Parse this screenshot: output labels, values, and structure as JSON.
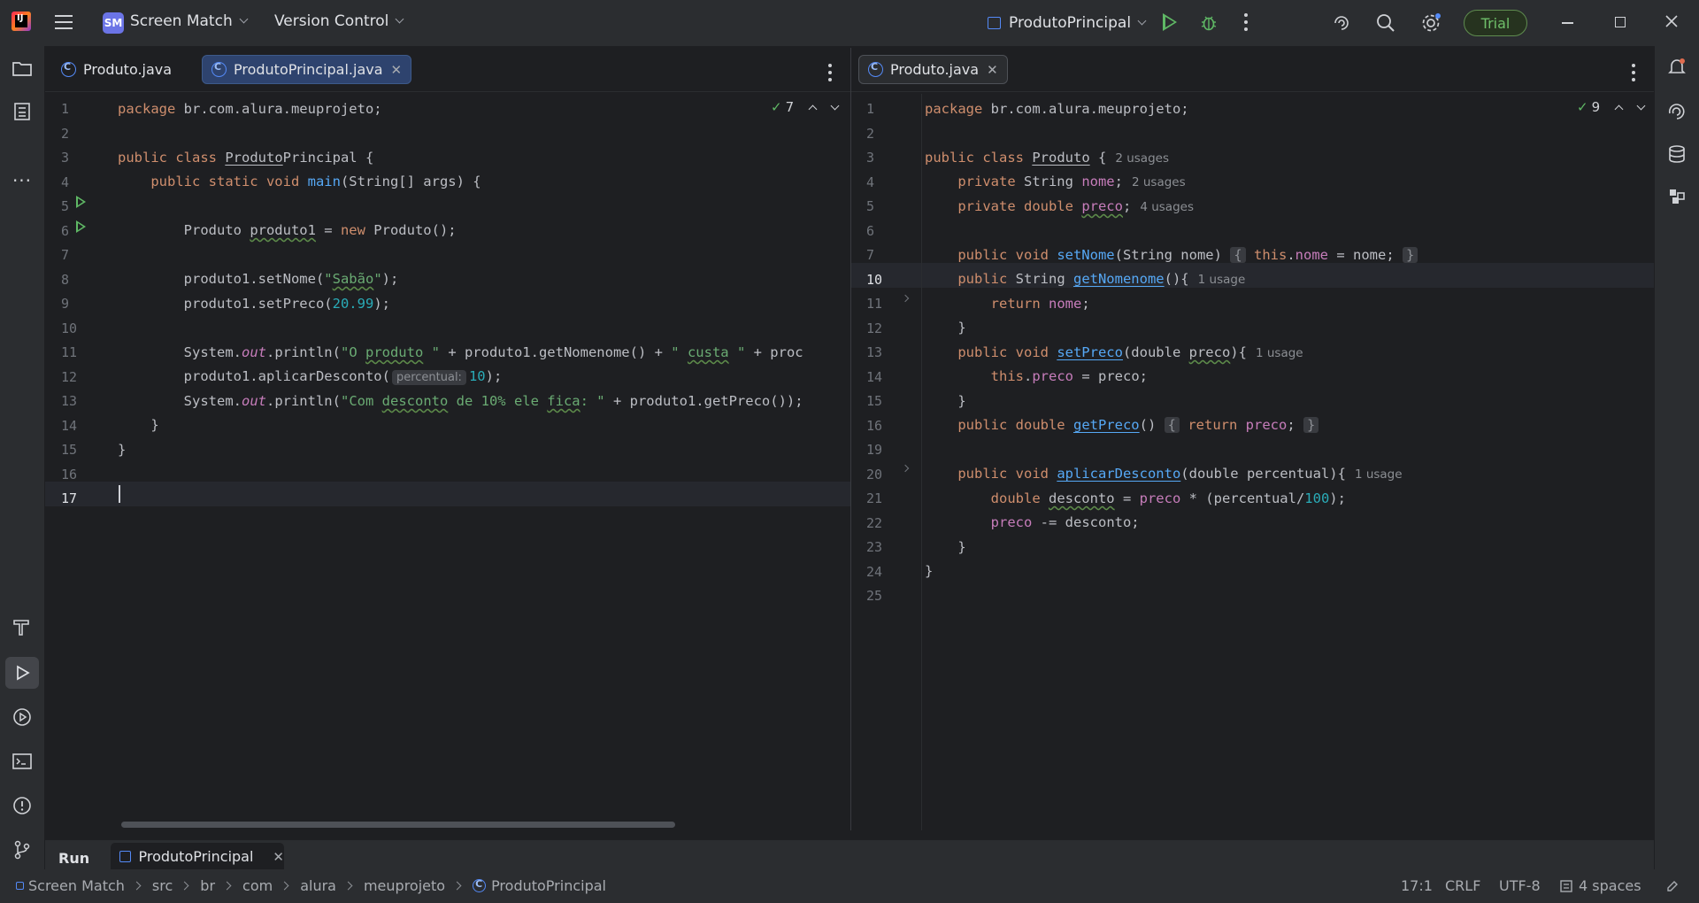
{
  "titlebar": {
    "project_badge": "SM",
    "project_name": "Screen Match",
    "vcs": "Version Control",
    "run_config": "ProdutoPrincipal",
    "trial": "Trial"
  },
  "left_editor": {
    "tabs": [
      {
        "label": "Produto.java",
        "active": false
      },
      {
        "label": "ProdutoPrincipal.java",
        "active": true
      }
    ],
    "inspection_count": "7",
    "line_numbers": [
      "1",
      "2",
      "3",
      "4",
      "5",
      "6",
      "7",
      "8",
      "9",
      "10",
      "11",
      "12",
      "13",
      "14",
      "15",
      "16",
      "17"
    ],
    "current_line": "17",
    "code": {
      "l1_pkg": "package",
      "l1_rest": " br.com.alura.meuprojeto;",
      "l3_kw": "public class ",
      "l3_name": "Produto",
      "l3_name2": "Principal",
      "l3_rest": " {",
      "l4_kw": "    public static void ",
      "l4_fn": "main",
      "l4_rest": "(String[] args) {",
      "l6_a": "        Produto ",
      "l6_var": "produto1",
      "l6_b": " = ",
      "l6_new": "new",
      "l6_c": " Produto();",
      "l8_a": "        produto1.setNome(",
      "l8_s1": "\"",
      "l8_s2": "Sabão",
      "l8_s3": "\"",
      "l8_b": ");",
      "l9_a": "        produto1.setPreco(",
      "l9_num": "20.99",
      "l9_b": ");",
      "l11_a": "        System.",
      "l11_out": "out",
      "l11_b": ".println(",
      "l11_s1": "\"O ",
      "l11_s2": "produto",
      "l11_s3": " \"",
      "l11_c": " + produto1.getNomenome() + ",
      "l11_s4": "\" ",
      "l11_s5": "custa",
      "l11_s6": " \"",
      "l11_d": " + proc",
      "l12_a": "        produto1.aplicarDesconto(",
      "l12_hint": "percentual:",
      "l12_num": "10",
      "l12_b": ");",
      "l13_a": "        System.",
      "l13_out": "out",
      "l13_b": ".println(",
      "l13_s1": "\"Com ",
      "l13_s2": "desconto",
      "l13_s3": " de 10% ele ",
      "l13_s4": "fica",
      "l13_s5": ": \"",
      "l13_c": " + produto1.getPreco());",
      "l14": "    }",
      "l15": "}"
    }
  },
  "right_editor": {
    "tabs": [
      {
        "label": "Produto.java",
        "active": true
      }
    ],
    "inspection_count": "9",
    "line_numbers": [
      "1",
      "2",
      "3",
      "4",
      "5",
      "6",
      "7",
      "10",
      "11",
      "12",
      "13",
      "14",
      "15",
      "16",
      "19",
      "20",
      "21",
      "22",
      "23",
      "24",
      "25"
    ],
    "current_line": "10",
    "code": {
      "r1_pkg": "package",
      "r1_rest": " br.com.alura.meuprojeto;",
      "r3_kw": "public class ",
      "r3_name": "Produto",
      "r3_rest": " {",
      "r3_hint": "2 usages",
      "r4_kw": "    private ",
      "r4_type": "String ",
      "r4_fld": "nome",
      "r4_rest": ";",
      "r4_hint": "2 usages",
      "r5_kw": "    private double ",
      "r5_fld": "preco",
      "r5_rest": ";",
      "r5_hint": "4 usages",
      "r7_kw": "    public void ",
      "r7_fn": "setNome",
      "r7_a": "(String nome)",
      "r7_fold1": "{",
      "r7_this": "this",
      "r7_b": ".",
      "r7_fld": "nome",
      "r7_c": " = nome;",
      "r7_fold2": "}",
      "r10_kw": "    public ",
      "r10_type": "String ",
      "r10_fn": "getNomenome",
      "r10_a": "(){",
      "r10_hint": "1 usage",
      "r11_kw": "        return ",
      "r11_fld": "nome",
      "r11_a": ";",
      "r12": "    }",
      "r13_kw": "    public void ",
      "r13_fn": "setPreco",
      "r13_a": "(double ",
      "r13_p": "preco",
      "r13_b": "){",
      "r13_hint": "1 usage",
      "r14_this": "        this",
      "r14_a": ".",
      "r14_fld": "preco",
      "r14_b": " = preco;",
      "r15": "    }",
      "r16_kw": "    public double ",
      "r16_fn": "getPreco",
      "r16_a": "()",
      "r16_fold1": "{",
      "r16_ret": "return ",
      "r16_fld": "preco",
      "r16_b": ";",
      "r16_fold2": "}",
      "r20_kw": "    public void ",
      "r20_fn": "aplicarDesconto",
      "r20_a": "(double percentual){",
      "r20_hint": "1 usage",
      "r21_kw": "        double ",
      "r21_var": "desconto",
      "r21_a": " = ",
      "r21_fld": "preco",
      "r21_b": " * (percentual/",
      "r21_num": "100",
      "r21_c": ");",
      "r22_fld": "        preco",
      "r22_a": " -= desconto;",
      "r23": "    }",
      "r24": "}"
    }
  },
  "run_panel": {
    "label": "Run",
    "tab": "ProdutoPrincipal"
  },
  "statusbar": {
    "breadcrumbs": [
      "Screen Match",
      "src",
      "br",
      "com",
      "alura",
      "meuprojeto",
      "ProdutoPrincipal"
    ],
    "position": "17:1",
    "line_sep": "CRLF",
    "encoding": "UTF-8",
    "indent": "4 spaces"
  },
  "colors": {
    "background": "#1e1f22",
    "panel": "#2b2d30",
    "keyword": "#cf8e6d",
    "function": "#56a8f5",
    "string": "#6aab73",
    "number": "#2aacb8",
    "field": "#c77dbb",
    "accent": "#548af7"
  }
}
